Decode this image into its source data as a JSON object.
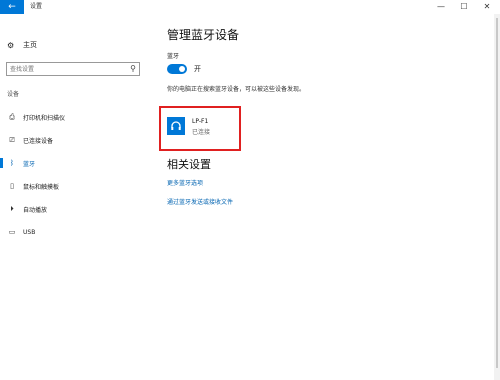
{
  "window": {
    "title": "设置",
    "back_glyph": "←",
    "minimize_glyph": "—",
    "maximize_glyph": "☐",
    "close_glyph": "✕"
  },
  "sidebar": {
    "home_label": "主页",
    "search_placeholder": "查找设置",
    "section_label": "设备",
    "items": [
      {
        "label": "打印机和扫描仪",
        "icon": "printer-icon",
        "glyph": "⎙"
      },
      {
        "label": "已连接设备",
        "icon": "devices-icon",
        "glyph": "⎚"
      },
      {
        "label": "蓝牙",
        "icon": "bluetooth-icon",
        "glyph": "ᛒ"
      },
      {
        "label": "鼠标和触摸板",
        "icon": "mouse-icon",
        "glyph": "▯"
      },
      {
        "label": "自动播放",
        "icon": "autoplay-icon",
        "glyph": "⏵"
      },
      {
        "label": "USB",
        "icon": "usb-icon",
        "glyph": "▭"
      }
    ],
    "active_index": 2
  },
  "main": {
    "title": "管理蓝牙设备",
    "bluetooth_label": "蓝牙",
    "toggle_state": "开",
    "toggle_on": true,
    "info_text": "你的电脑正在搜索蓝牙设备，可以被这些设备发现。",
    "device": {
      "name": "LP-F1",
      "status": "已连接",
      "icon": "headset-icon"
    },
    "related_title": "相关设置",
    "links": [
      "更多蓝牙选项",
      "通过蓝牙发送或接收文件"
    ]
  },
  "colors": {
    "accent": "#0078d7",
    "link": "#0063b1",
    "highlight_border": "#e02020"
  }
}
